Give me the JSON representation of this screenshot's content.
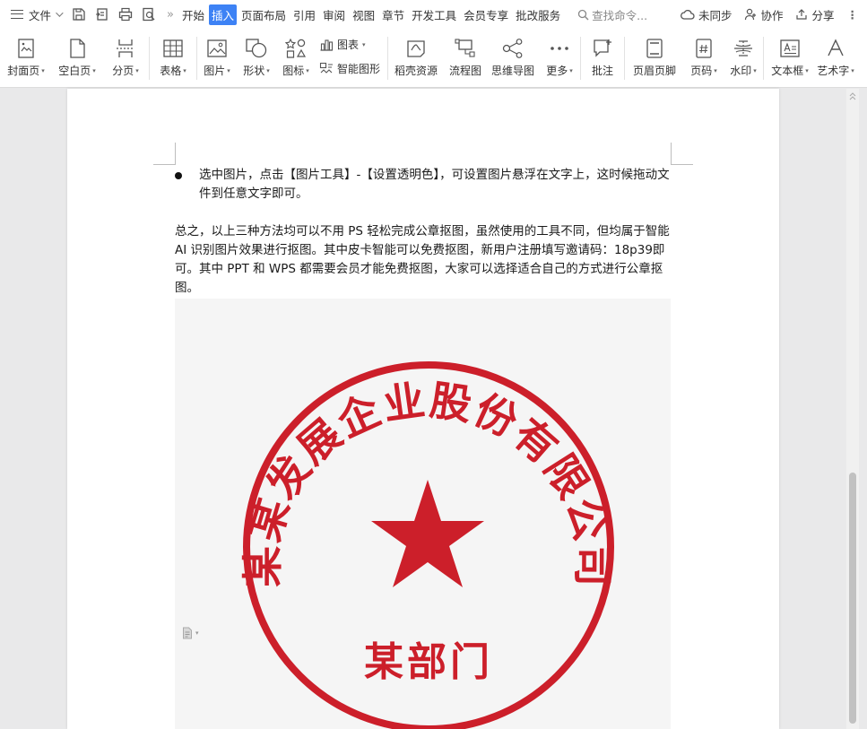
{
  "menubar": {
    "file_label": "文件",
    "tabs": [
      "开始",
      "插入",
      "页面布局",
      "引用",
      "审阅",
      "视图",
      "章节",
      "开发工具",
      "会员专享",
      "批改服务"
    ],
    "active_tab": "插入",
    "search_placeholder": "查找命令...",
    "sync_label": "未同步",
    "collab_label": "协作",
    "share_label": "分享"
  },
  "ribbon": {
    "cover_page": "封面页",
    "blank_page": "空白页",
    "page_break": "分页",
    "table": "表格",
    "picture": "图片",
    "shapes": "形状",
    "icons": "图标",
    "chart": "图表",
    "smart_graphic": "智能图形",
    "docer_resources": "稻壳资源",
    "flowchart": "流程图",
    "mindmap": "思维导图",
    "more": "更多",
    "comment": "批注",
    "header_footer": "页眉页脚",
    "page_number": "页码",
    "watermark": "水印",
    "text_box": "文本框",
    "word_art": "艺术字"
  },
  "document": {
    "bullet_text": "选中图片，点击【图片工具】-【设置透明色】，可设置图片悬浮在文字上，这时候拖动文件到任意文字即可。",
    "paragraph": "总之，以上三种方法均可以不用 PS 轻松完成公章抠图，虽然使用的工具不同，但均属于智能 AI 识别图片效果进行抠图。其中皮卡智能可以免费抠图，新用户注册填写邀请码：18p39即可。其中 PPT 和 WPS 都需要会员才能免费抠图，大家可以选择适合自己的方式进行公章抠图。",
    "stamp": {
      "ring_text": "某某发展企业股份有限公司",
      "department": "某部门",
      "color": "#cc1f2a"
    }
  },
  "colors": {
    "accent": "#3d82f5",
    "icon": "#555555"
  }
}
